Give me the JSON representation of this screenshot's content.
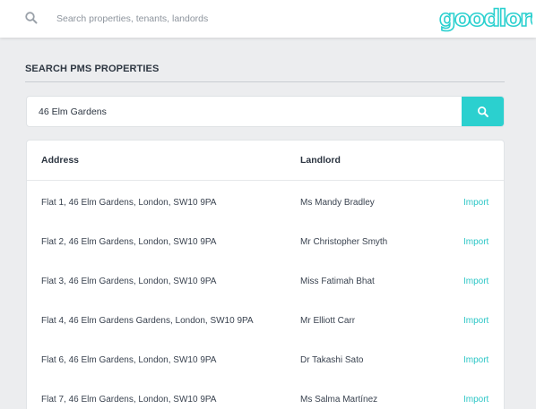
{
  "topbar": {
    "search_placeholder": "Search properties, tenants, landords",
    "logo_text": "goodlord"
  },
  "colors": {
    "accent": "#2bd0cf",
    "link": "#2bc6c6",
    "background": "#ecedef"
  },
  "page": {
    "section_title": "SEARCH PMS PROPERTIES"
  },
  "search": {
    "value": "46 Elm Gardens",
    "button_icon": "search-icon"
  },
  "table": {
    "headers": {
      "address": "Address",
      "landlord": "Landlord"
    },
    "rows": [
      {
        "address": "Flat 1, 46 Elm Gardens, London, SW10 9PA",
        "landlord": "Ms Mandy Bradley",
        "action": "Import"
      },
      {
        "address": "Flat 2, 46 Elm Gardens, London, SW10 9PA",
        "landlord": "Mr Christopher Smyth",
        "action": "Import"
      },
      {
        "address": "Flat 3, 46 Elm Gardens, London, SW10 9PA",
        "landlord": "Miss Fatimah Bhat",
        "action": "Import"
      },
      {
        "address": "Flat 4, 46 Elm Gardens Gardens, London, SW10 9PA",
        "landlord": "Mr Elliott Carr",
        "action": "Import"
      },
      {
        "address": "Flat 6, 46 Elm Gardens, London, SW10 9PA",
        "landlord": "Dr Takashi Sato",
        "action": "Import"
      },
      {
        "address": "Flat 7, 46 Elm Gardens, London, SW10 9PA",
        "landlord": "Ms Salma Martínez",
        "action": "Import"
      }
    ]
  }
}
